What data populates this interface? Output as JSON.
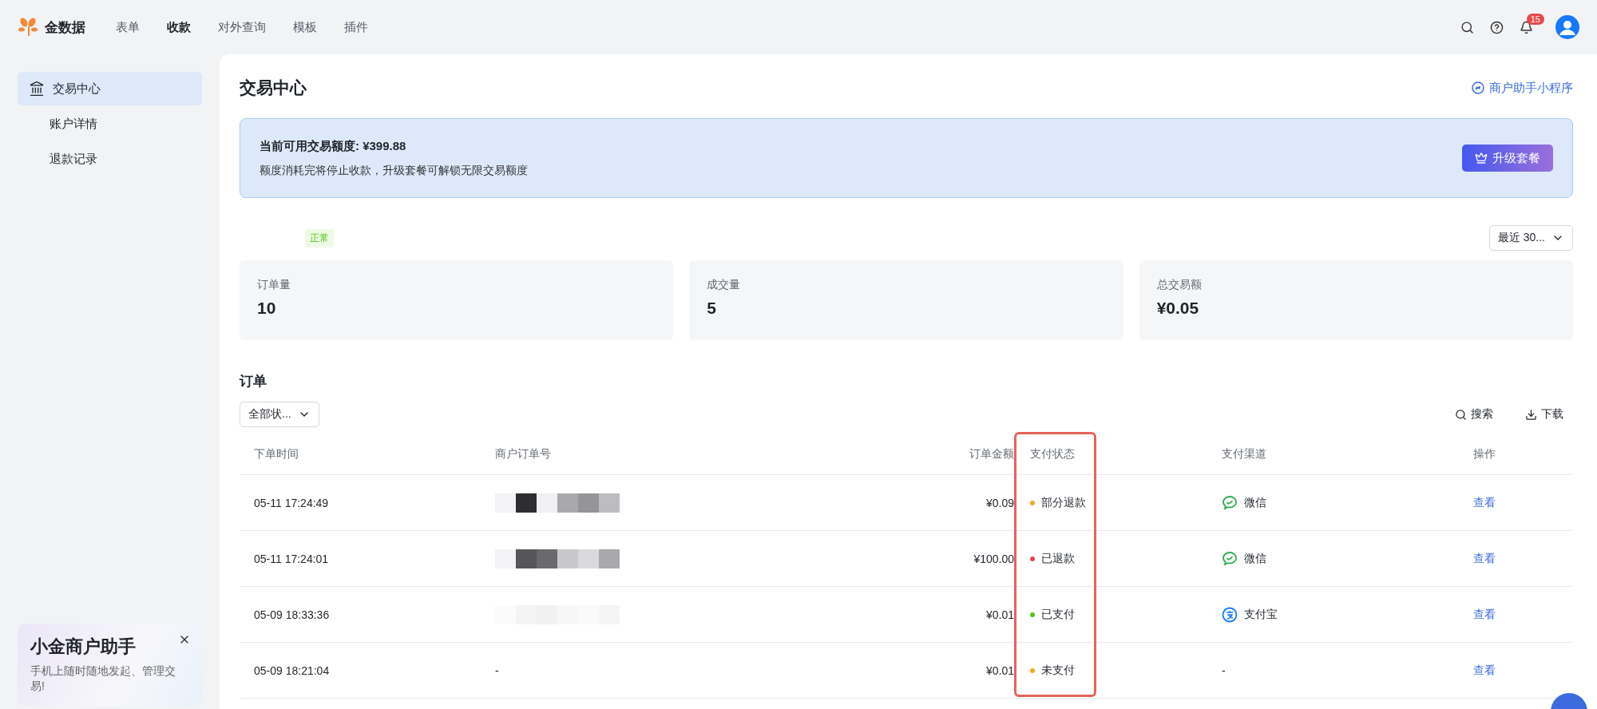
{
  "brand": "金数据",
  "nav": [
    {
      "label": "表单",
      "selected": false
    },
    {
      "label": "收款",
      "selected": true
    },
    {
      "label": "对外查询",
      "selected": false
    },
    {
      "label": "模板",
      "selected": false
    },
    {
      "label": "插件",
      "selected": false
    }
  ],
  "notification_count": "15",
  "sidebar": {
    "items": [
      {
        "label": "交易中心",
        "selected": true,
        "kind": "icon"
      },
      {
        "label": "账户详情",
        "selected": false,
        "kind": "plain"
      },
      {
        "label": "退款记录",
        "selected": false,
        "kind": "plain"
      }
    ],
    "promo": {
      "title": "小金商户助手",
      "text": "手机上随时随地发起、管理交易!"
    }
  },
  "page": {
    "title": "交易中心",
    "mini_program_link": "商户助手小程序"
  },
  "banner": {
    "quota": "当前可用交易额度: ¥399.88",
    "note": "额度消耗完将停止收款，升级套餐可解锁无限交易额度",
    "button": "升级套餐"
  },
  "status_tag": "正常",
  "range_select": "最近 30...",
  "stats": [
    {
      "label": "订单量",
      "value": "10"
    },
    {
      "label": "成交量",
      "value": "5"
    },
    {
      "label": "总交易额",
      "value": "¥0.05"
    }
  ],
  "orders": {
    "title": "订单",
    "filter": "全部状...",
    "search": "搜索",
    "download": "下载",
    "columns": [
      "下单时间",
      "商户订单号",
      "订单金额",
      "支付状态",
      "支付渠道",
      "操作"
    ],
    "rows": [
      {
        "time": "05-11 17:24:49",
        "redacted": true,
        "amount": "¥0.09",
        "status": "部分退款",
        "color": "#f5a623",
        "channel": {
          "kind": "wechat",
          "label": "微信"
        },
        "action": "查看"
      },
      {
        "time": "05-11 17:24:01",
        "redacted": true,
        "amount": "¥100.00",
        "status": "已退款",
        "color": "#e5484d",
        "channel": {
          "kind": "wechat",
          "label": "微信"
        },
        "action": "查看"
      },
      {
        "time": "05-09 18:33:36",
        "redacted": true,
        "amount": "¥0.01",
        "status": "已支付",
        "color": "#52c41a",
        "channel": {
          "kind": "alipay",
          "label": "支付宝"
        },
        "action": "查看"
      },
      {
        "time": "05-09 18:21:04",
        "redacted": false,
        "order_no": "-",
        "amount": "¥0.01",
        "status": "未支付",
        "color": "#f5a623",
        "channel": {
          "kind": "none",
          "label": "-"
        },
        "action": "查看"
      }
    ]
  }
}
